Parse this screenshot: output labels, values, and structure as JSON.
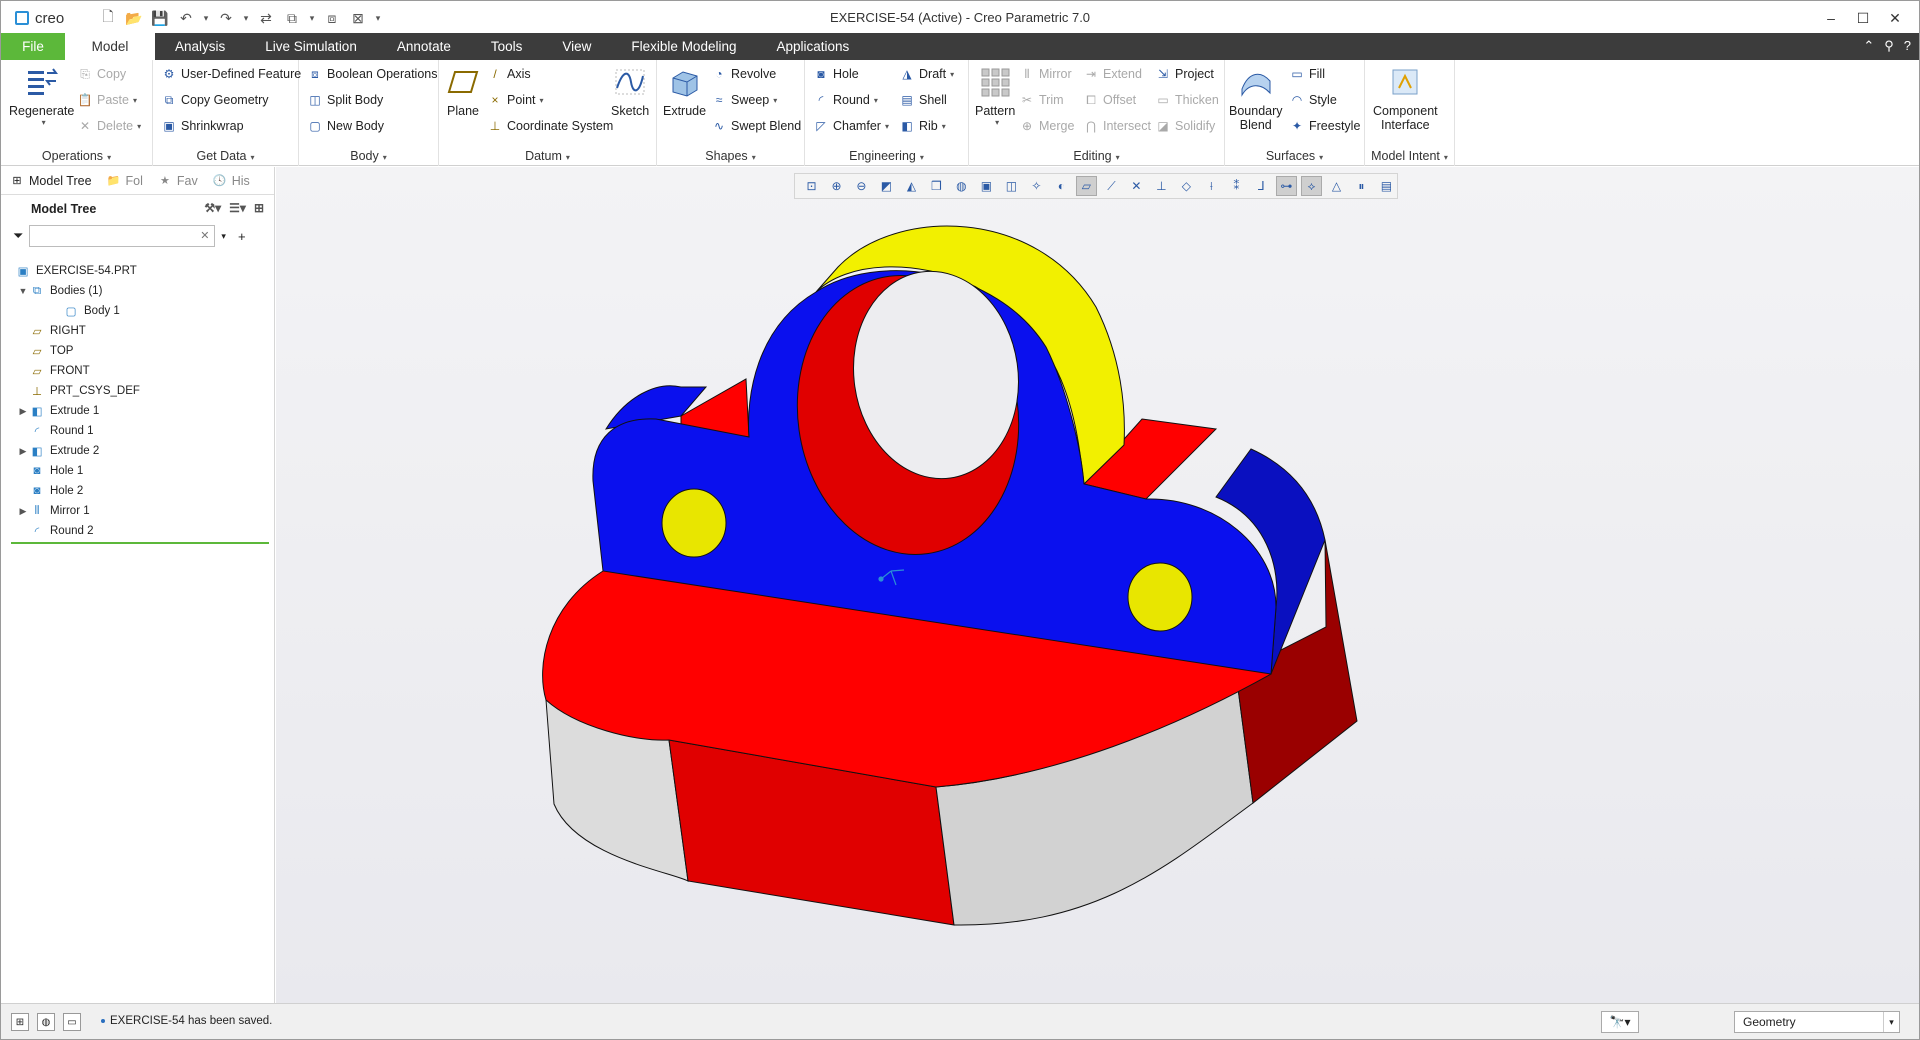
{
  "titlebar": {
    "app": "creo",
    "title": "EXERCISE-54 (Active) - Creo Parametric 7.0"
  },
  "tabs": [
    "File",
    "Model",
    "Analysis",
    "Live Simulation",
    "Annotate",
    "Tools",
    "View",
    "Flexible Modeling",
    "Applications"
  ],
  "ribbon": {
    "operations": {
      "label": "Operations",
      "regenerate": "Regenerate",
      "copy": "Copy",
      "paste": "Paste",
      "delete": "Delete"
    },
    "get_data": {
      "label": "Get Data",
      "udf": "User-Defined Feature",
      "copy_geometry": "Copy Geometry",
      "shrinkwrap": "Shrinkwrap"
    },
    "body": {
      "label": "Body",
      "boolean": "Boolean Operations",
      "split": "Split Body",
      "new": "New Body"
    },
    "datum": {
      "label": "Datum",
      "plane": "Plane",
      "axis": "Axis",
      "point": "Point",
      "csys": "Coordinate System",
      "sketch": "Sketch"
    },
    "shapes": {
      "label": "Shapes",
      "extrude": "Extrude",
      "revolve": "Revolve",
      "sweep": "Sweep",
      "swept_blend": "Swept Blend"
    },
    "engineering": {
      "label": "Engineering",
      "hole": "Hole",
      "round": "Round",
      "chamfer": "Chamfer",
      "draft": "Draft",
      "shell": "Shell",
      "rib": "Rib"
    },
    "editing": {
      "label": "Editing",
      "pattern": "Pattern",
      "mirror": "Mirror",
      "trim": "Trim",
      "merge": "Merge",
      "extend": "Extend",
      "offset": "Offset",
      "intersect": "Intersect",
      "project": "Project",
      "thicken": "Thicken",
      "solidify": "Solidify"
    },
    "surfaces": {
      "label": "Surfaces",
      "boundary_blend_1": "Boundary",
      "boundary_blend_2": "Blend",
      "fill": "Fill",
      "style": "Style",
      "freestyle": "Freestyle"
    },
    "model_intent": {
      "label": "Model Intent",
      "component_interface_1": "Component",
      "component_interface_2": "Interface"
    }
  },
  "panel": {
    "tabs": [
      "Model Tree",
      "Fol",
      "Fav",
      "His"
    ],
    "header": "Model Tree",
    "search_value": "",
    "tree": [
      {
        "label": "EXERCISE-54.PRT",
        "icon": "part-icon",
        "indent": 0,
        "expander": ""
      },
      {
        "label": "Bodies (1)",
        "icon": "bodies-icon",
        "indent": 1,
        "expander": "open"
      },
      {
        "label": "Body 1",
        "icon": "body-icon",
        "indent": 2,
        "expander": ""
      },
      {
        "label": "RIGHT",
        "icon": "datum-plane-icon",
        "indent": 1,
        "expander": ""
      },
      {
        "label": "TOP",
        "icon": "datum-plane-icon",
        "indent": 1,
        "expander": ""
      },
      {
        "label": "FRONT",
        "icon": "datum-plane-icon",
        "indent": 1,
        "expander": ""
      },
      {
        "label": "PRT_CSYS_DEF",
        "icon": "csys-icon",
        "indent": 1,
        "expander": ""
      },
      {
        "label": "Extrude 1",
        "icon": "extrude-icon",
        "indent": 1,
        "expander": "closed"
      },
      {
        "label": "Round 1",
        "icon": "round-icon",
        "indent": 1,
        "expander": ""
      },
      {
        "label": "Extrude 2",
        "icon": "extrude-icon",
        "indent": 1,
        "expander": "closed"
      },
      {
        "label": "Hole 1",
        "icon": "hole-icon",
        "indent": 1,
        "expander": ""
      },
      {
        "label": "Hole 2",
        "icon": "hole-icon",
        "indent": 1,
        "expander": ""
      },
      {
        "label": "Mirror 1",
        "icon": "mirror-icon",
        "indent": 1,
        "expander": "closed"
      },
      {
        "label": "Round 2",
        "icon": "round-icon",
        "indent": 1,
        "expander": ""
      }
    ]
  },
  "status": {
    "message": "EXERCISE-54 has been saved.",
    "filter": "Geometry"
  },
  "colors": {
    "ribbon_tabs_bg": "#3c3c3c",
    "file_tab": "#5cb83a",
    "model_blue": "#0a10ee",
    "model_red": "#ff0000",
    "model_yellow": "#f0ee00",
    "model_gray": "#d8d8d8"
  }
}
